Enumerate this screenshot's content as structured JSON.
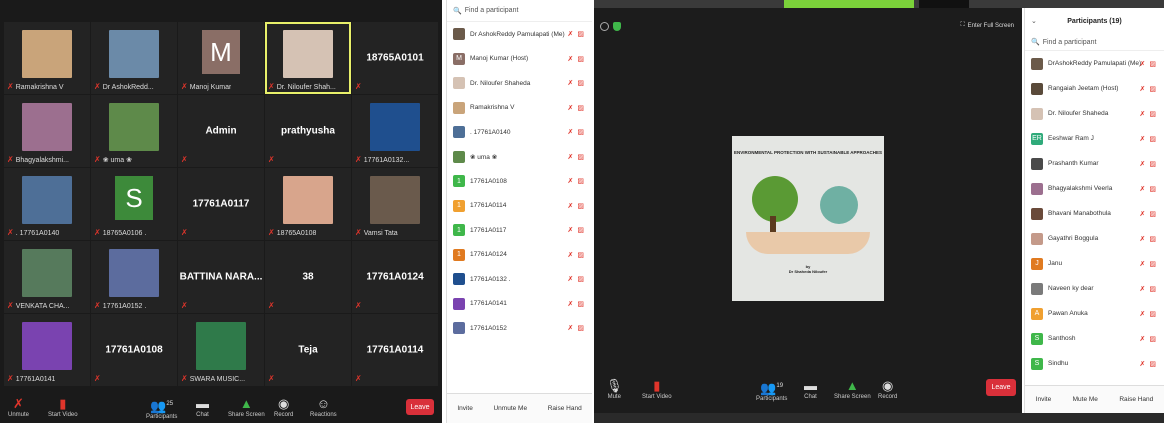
{
  "left": {
    "tiles": [
      {
        "type": "photo",
        "name": "Ramakrishna V",
        "color": "#c9a47a",
        "active": false
      },
      {
        "type": "photo",
        "name": "Dr AshokRedd...",
        "color": "#6b8aa8",
        "active": false
      },
      {
        "type": "letter",
        "name": "Manoj Kumar",
        "letter": "M",
        "color": "#8a6e66",
        "active": false
      },
      {
        "type": "photo",
        "name": "Dr. Niloufer Shah...",
        "color": "#d5c2b4",
        "active": true
      },
      {
        "type": "text",
        "name": "",
        "text": "18765A0101",
        "active": false
      },
      {
        "type": "photo",
        "name": "Bhagyalakshmi...",
        "color": "#9c6f8f",
        "active": false
      },
      {
        "type": "photo",
        "name": "❀ uma ❀",
        "color": "#5e8a4a",
        "active": false
      },
      {
        "type": "text",
        "name": "",
        "text": "Admin",
        "active": false
      },
      {
        "type": "text",
        "name": "",
        "text": "prathyusha",
        "active": false
      },
      {
        "type": "photo",
        "name": "17761A0132...",
        "color": "#1f4f8e",
        "active": false
      },
      {
        "type": "photo",
        "name": ". 17761A0140",
        "color": "#4e6f97",
        "active": false
      },
      {
        "type": "letter",
        "name": "18765A0106 .",
        "letter": "S",
        "color": "#3d8a3a",
        "active": false
      },
      {
        "type": "text",
        "name": "",
        "text": "17761A0117",
        "active": false
      },
      {
        "type": "photo",
        "name": "18765A0108",
        "color": "#d8a58c",
        "active": false
      },
      {
        "type": "photo",
        "name": "Vamsi Tata",
        "color": "#6a5a4c",
        "active": false
      },
      {
        "type": "photo",
        "name": "VENKATA CHA...",
        "color": "#567a5c",
        "active": false
      },
      {
        "type": "photo",
        "name": "17761A0152 .",
        "color": "#5c6c9e",
        "active": false
      },
      {
        "type": "text",
        "name": "",
        "text": "BATTINA NARA...",
        "active": false
      },
      {
        "type": "text",
        "name": "",
        "text": "38",
        "active": false
      },
      {
        "type": "text",
        "name": "",
        "text": "17761A0124",
        "active": false
      },
      {
        "type": "photo",
        "name": "17761A0141",
        "color": "#7a43b0",
        "active": false
      },
      {
        "type": "text",
        "name": "",
        "text": "17761A0108",
        "active": false
      },
      {
        "type": "photo",
        "name": "SWARA MUSIC...",
        "color": "#2f7a4a",
        "active": false
      },
      {
        "type": "text",
        "name": "",
        "text": "Teja",
        "active": false
      },
      {
        "type": "text",
        "name": "",
        "text": "17761A0114",
        "active": false
      }
    ],
    "toolbar": {
      "unmute": "Unmute",
      "start_video": "Start Video",
      "participants": "Participants",
      "participant_count": "25",
      "chat": "Chat",
      "share_screen": "Share Screen",
      "record": "Record",
      "reactions": "Reactions",
      "leave": "Leave"
    },
    "participants_panel": {
      "search_placeholder": "Find a participant",
      "rows": [
        {
          "name": "Dr AshokReddy Pamulapati (Me)",
          "avatar": "photo",
          "color": "#6b5a4a"
        },
        {
          "name": "Manoj Kumar (Host)",
          "avatar": "M",
          "color": "#8a6e66"
        },
        {
          "name": "Dr. Niloufer Shaheda",
          "avatar": "photo",
          "color": "#d5c2b4"
        },
        {
          "name": "Ramakrishna V",
          "avatar": "photo",
          "color": "#c9a47a"
        },
        {
          "name": ". 17761A0140",
          "avatar": "photo",
          "color": "#4e6f97"
        },
        {
          "name": "❀ uma ❀",
          "avatar": "photo",
          "color": "#5e8a4a"
        },
        {
          "name": "17761A0108",
          "avatar": "1",
          "color": "#3fb74a"
        },
        {
          "name": "17761A0114",
          "avatar": "1",
          "color": "#f0a030"
        },
        {
          "name": "17761A0117",
          "avatar": "1",
          "color": "#3fb74a"
        },
        {
          "name": "17761A0124",
          "avatar": "1",
          "color": "#e07a20"
        },
        {
          "name": "17761A0132 .",
          "avatar": "photo",
          "color": "#1f4f8e"
        },
        {
          "name": "17761A0141",
          "avatar": "photo",
          "color": "#7a43b0"
        },
        {
          "name": "17761A0152",
          "avatar": "photo",
          "color": "#5c6c9e"
        }
      ],
      "invite": "Invite",
      "unmute_me": "Unmute Me",
      "raise_hand": "Raise Hand"
    }
  },
  "right": {
    "enter_full_screen": "Enter Full Screen",
    "slide": {
      "title": "ENVIRONMENTAL PROTECTION WITH SUSTAINABLE APPROACHES",
      "by": "by",
      "author": "Dr Shaheda Niloufer"
    },
    "toolbar": {
      "mute": "Mute",
      "start_video": "Start Video",
      "participants": "Participants",
      "participant_count": "19",
      "chat": "Chat",
      "share_screen": "Share Screen",
      "record": "Record",
      "leave": "Leave"
    },
    "participants_panel": {
      "title": "Participants (19)",
      "search_placeholder": "Find a participant",
      "rows": [
        {
          "name": "DrAshokReddy Pamulapati (Me)",
          "avatar": "photo",
          "color": "#6b5a4a"
        },
        {
          "name": "Rangaiah Jeetam (Host)",
          "avatar": "photo",
          "color": "#5a4a3a"
        },
        {
          "name": "Dr. Niloufer Shaheda",
          "avatar": "photo",
          "color": "#d5c2b4"
        },
        {
          "name": "Eeshwar Ram J",
          "avatar": "ER",
          "color": "#2faa7a"
        },
        {
          "name": "Prashanth Kumar",
          "avatar": "photo",
          "color": "#4a4a4a"
        },
        {
          "name": "Bhagyalakshmi Veerla",
          "avatar": "photo",
          "color": "#9c6f8f"
        },
        {
          "name": "Bhavani Manabothula",
          "avatar": "photo",
          "color": "#6a4a3a"
        },
        {
          "name": "Gayathri Boggula",
          "avatar": "photo",
          "color": "#c49a8a"
        },
        {
          "name": "Janu",
          "avatar": "J",
          "color": "#e07a20"
        },
        {
          "name": "Naveen ky dear",
          "avatar": "photo",
          "color": "#7a7a7a"
        },
        {
          "name": "Pawan Anuka",
          "avatar": "A",
          "color": "#f0a030"
        },
        {
          "name": "Santhosh",
          "avatar": "S",
          "color": "#3fb74a"
        },
        {
          "name": "Sindhu",
          "avatar": "S",
          "color": "#3fb74a"
        }
      ],
      "invite": "Invite",
      "mute_me": "Mute Me",
      "raise_hand": "Raise Hand"
    }
  }
}
